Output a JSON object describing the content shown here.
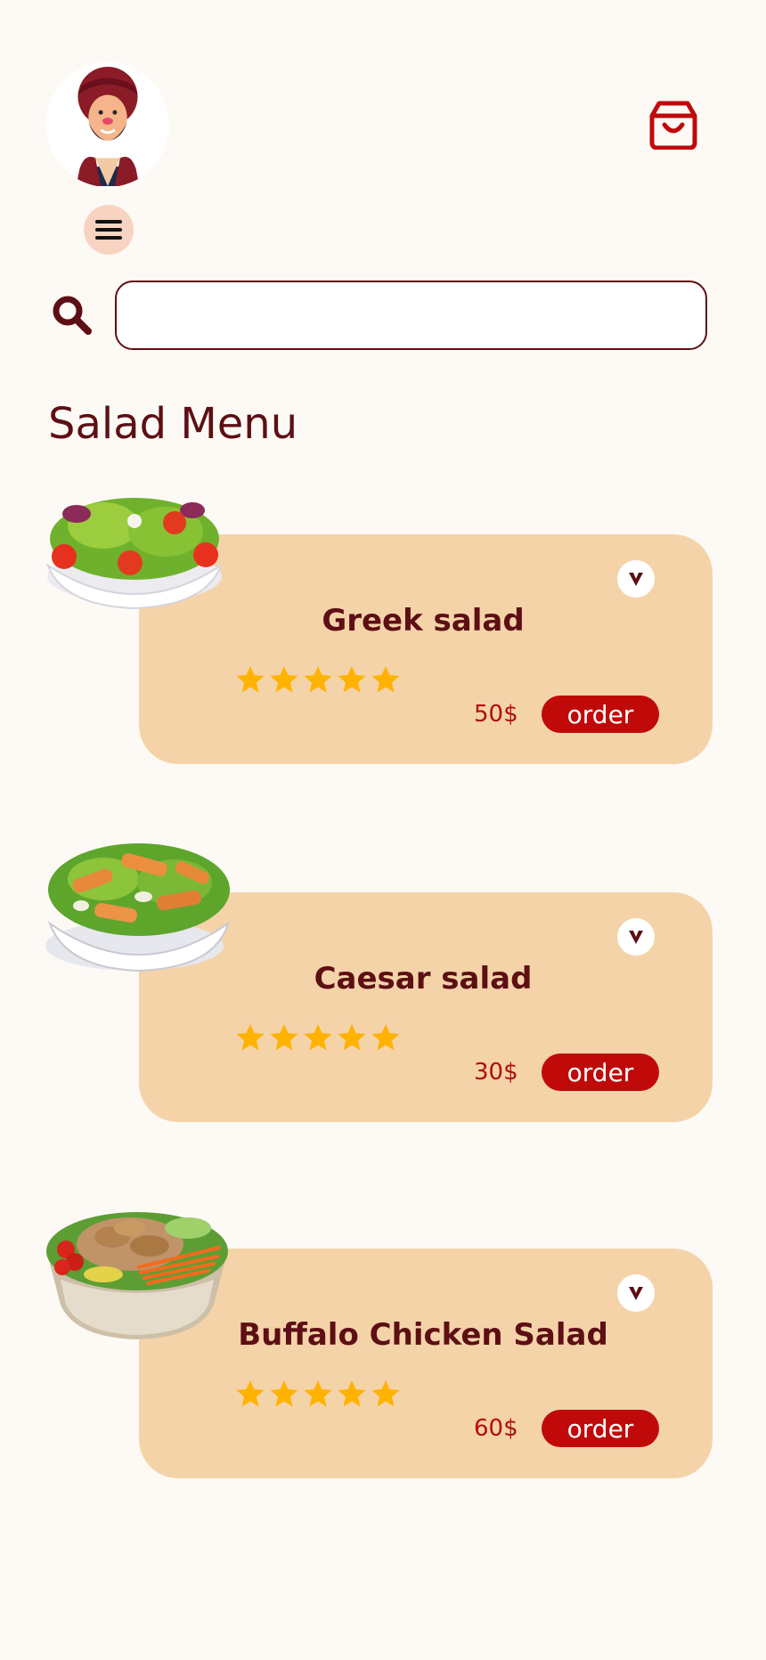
{
  "header": {
    "avatar_icon": "user-avatar-icon",
    "cart_icon": "shopping-bag-icon",
    "menu_icon": "hamburger-menu-icon"
  },
  "search": {
    "icon": "search-icon",
    "value": "",
    "placeholder": ""
  },
  "page_title": "Salad Menu",
  "colors": {
    "background": "#fdfaf5",
    "primary": "#5d0f14",
    "accent": "#c00a0a",
    "card": "#f5d3a9",
    "star": "#ffb300",
    "menu_button": "#f8d3c1"
  },
  "menu": {
    "items": [
      {
        "name": "Greek salad",
        "price": "50$",
        "order_label": "order",
        "rating": 5,
        "image": "greek-salad-image"
      },
      {
        "name": "Caesar salad",
        "price": "30$",
        "order_label": "order",
        "rating": 5,
        "image": "caesar-salad-image"
      },
      {
        "name": "Buffalo Chicken Salad",
        "price": "60$",
        "order_label": "order",
        "rating": 5,
        "image": "buffalo-chicken-salad-image"
      }
    ]
  }
}
